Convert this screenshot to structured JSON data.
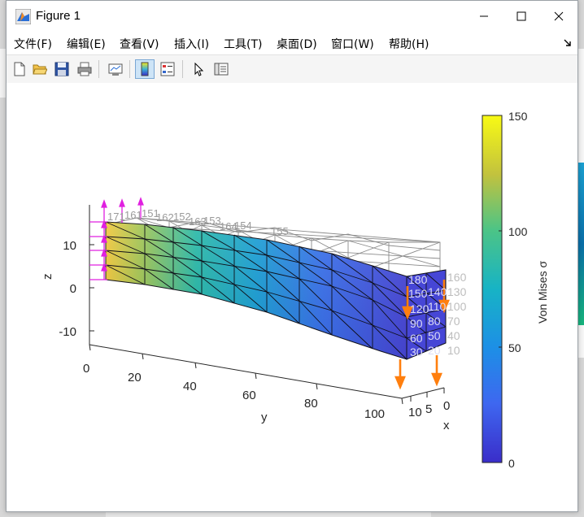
{
  "window": {
    "title": "Figure 1",
    "menu": [
      {
        "label": "文件(F)",
        "name": "menu-file"
      },
      {
        "label": "编辑(E)",
        "name": "menu-edit"
      },
      {
        "label": "查看(V)",
        "name": "menu-view"
      },
      {
        "label": "插入(I)",
        "name": "menu-insert"
      },
      {
        "label": "工具(T)",
        "name": "menu-tools"
      },
      {
        "label": "桌面(D)",
        "name": "menu-desktop"
      },
      {
        "label": "窗口(W)",
        "name": "menu-window"
      },
      {
        "label": "帮助(H)",
        "name": "menu-help"
      }
    ],
    "menu_overflow_icon": "dock-arrow-icon"
  },
  "toolbar": {
    "buttons": [
      {
        "name": "new-figure-button",
        "icon": "new-document-icon"
      },
      {
        "name": "open-file-button",
        "icon": "folder-open-icon"
      },
      {
        "name": "save-figure-button",
        "icon": "floppy-disk-icon"
      },
      {
        "name": "print-figure-button",
        "icon": "printer-icon"
      },
      {
        "name": "link-plot-button",
        "icon": "link-plot-icon"
      },
      {
        "name": "insert-colorbar-button",
        "icon": "colorbar-icon",
        "active": true
      },
      {
        "name": "insert-legend-button",
        "icon": "legend-icon"
      },
      {
        "name": "edit-plot-button",
        "icon": "pointer-arrow-icon"
      },
      {
        "name": "property-inspector-button",
        "icon": "property-inspector-icon"
      }
    ]
  },
  "plot": {
    "zlabel": "z",
    "ylabel": "y",
    "xlabel": "x",
    "z_ticks": [
      "10",
      "0",
      "-10"
    ],
    "y_ticks": [
      "0",
      "20",
      "40",
      "60",
      "80",
      "100"
    ],
    "x_ticks": [
      "10",
      "5",
      "0"
    ],
    "colorbar": {
      "label": "Von Mises σ",
      "ticks": [
        "150",
        "100",
        "50",
        "0"
      ],
      "range": [
        0,
        150
      ],
      "colors": [
        "#3a2dc9",
        "#3e67f0",
        "#17a0db",
        "#16bca5",
        "#74c95a",
        "#f5b832",
        "#f8fa14"
      ]
    },
    "top_node_labels": [
      "171",
      "161",
      "151",
      "162",
      "152",
      "163",
      "153",
      "164",
      "154",
      "155"
    ],
    "end_labels_right": [
      "160",
      "130",
      "100",
      "70",
      "40",
      "10"
    ],
    "end_labels_mid": [
      "180",
      "150",
      "140",
      "120",
      "110",
      "90",
      "80",
      "60",
      "50",
      "30",
      "20"
    ],
    "load_arrow_color": "#ff7f0e",
    "constraint_color": "#e020e0"
  }
}
